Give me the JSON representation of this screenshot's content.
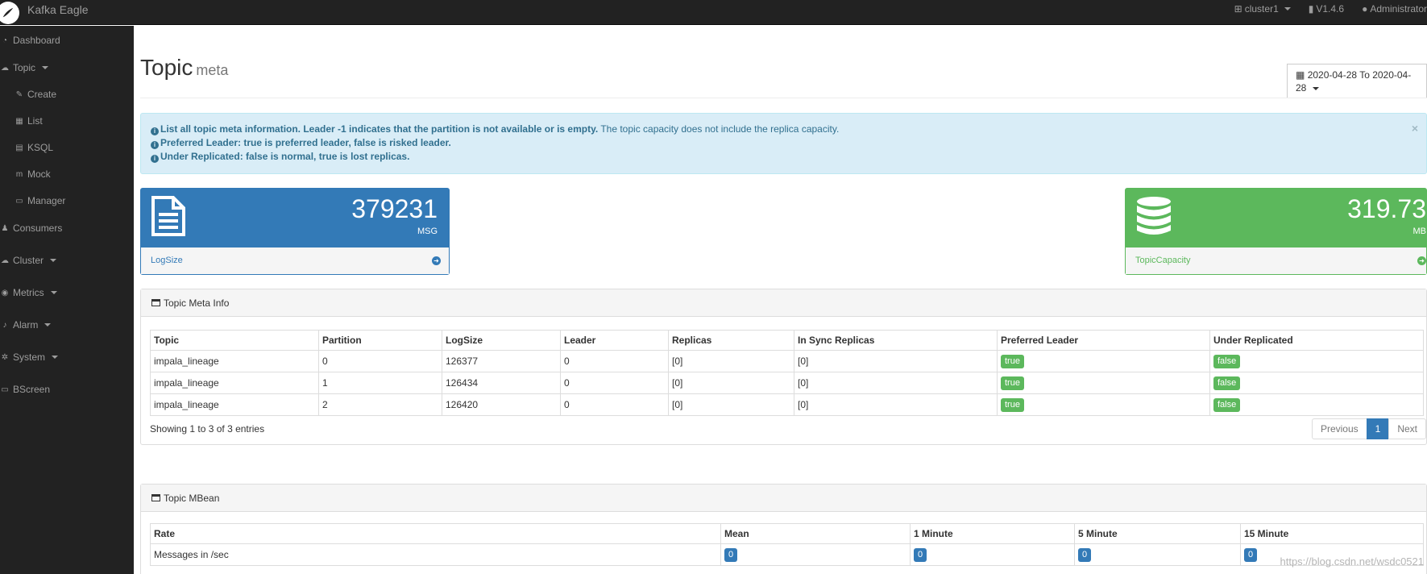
{
  "navbar": {
    "brand": "Kafka Eagle",
    "cluster": "cluster1",
    "version": "V1.4.6",
    "user": "Administrator"
  },
  "sidebar": {
    "items": [
      {
        "label": "Dashboard",
        "icon": "dashboard-icon"
      },
      {
        "label": "Topic",
        "icon": "comments-icon",
        "dropdown": true
      },
      {
        "label": "Create",
        "icon": "edit-icon",
        "sub": true
      },
      {
        "label": "List",
        "icon": "table-icon",
        "sub": true
      },
      {
        "label": "KSQL",
        "icon": "file-icon",
        "sub": true
      },
      {
        "label": "Mock",
        "icon": "maxcdn-icon",
        "sub": true
      },
      {
        "label": "Manager",
        "icon": "list-icon",
        "sub": true
      },
      {
        "label": "Consumers",
        "icon": "users-icon"
      },
      {
        "label": "Cluster",
        "icon": "cloud-icon",
        "dropdown": true
      },
      {
        "label": "Metrics",
        "icon": "eye-icon",
        "dropdown": true
      },
      {
        "label": "Alarm",
        "icon": "bell-icon",
        "dropdown": true
      },
      {
        "label": "System",
        "icon": "cog-icon",
        "dropdown": true
      },
      {
        "label": "BScreen",
        "icon": "desktop-icon"
      }
    ]
  },
  "page": {
    "title": "Topic",
    "subtitle": "meta",
    "date_range": "2020-04-28 To 2020-04-28"
  },
  "alert": {
    "line1_bold": "List all topic meta information. Leader -1 indicates that the partition is not available or is empty.",
    "line1_rest": " The topic capacity does not include the replica capacity.",
    "line2": "Preferred Leader: true is preferred leader, false is risked leader.",
    "line3": "Under Replicated: false is normal, true is lost replicas.",
    "close": "×"
  },
  "stats": {
    "logsize": {
      "value": "379231",
      "unit": "MSG",
      "label": "LogSize"
    },
    "capacity": {
      "value": "319.73",
      "unit": "MB",
      "label": "TopicCapacity"
    }
  },
  "meta_panel": {
    "title": "Topic Meta Info",
    "headers": [
      "Topic",
      "Partition",
      "LogSize",
      "Leader",
      "Replicas",
      "In Sync Replicas",
      "Preferred Leader",
      "Under Replicated"
    ],
    "rows": [
      {
        "topic": "impala_lineage",
        "partition": "0",
        "logsize": "126377",
        "leader": "0",
        "replicas": "[0]",
        "isr": "[0]",
        "preferred": "true",
        "under": "false"
      },
      {
        "topic": "impala_lineage",
        "partition": "1",
        "logsize": "126434",
        "leader": "0",
        "replicas": "[0]",
        "isr": "[0]",
        "preferred": "true",
        "under": "false"
      },
      {
        "topic": "impala_lineage",
        "partition": "2",
        "logsize": "126420",
        "leader": "0",
        "replicas": "[0]",
        "isr": "[0]",
        "preferred": "true",
        "under": "false"
      }
    ],
    "showing": "Showing 1 to 3 of 3 entries",
    "pagination": {
      "previous": "Previous",
      "page": "1",
      "next": "Next"
    }
  },
  "mbean_panel": {
    "title": "Topic MBean",
    "headers": [
      "Rate",
      "Mean",
      "1 Minute",
      "5 Minute",
      "15 Minute"
    ],
    "rows": [
      {
        "rate": "Messages in /sec",
        "mean": "0",
        "m1": "0",
        "m5": "0",
        "m15": "0"
      }
    ]
  },
  "watermark": "https://blog.csdn.net/wsdc0521",
  "colors": {
    "navbar": "#222222",
    "primary": "#337ab7",
    "success": "#5cb85c",
    "info_bg": "#d9edf7",
    "info_text": "#31708f"
  }
}
